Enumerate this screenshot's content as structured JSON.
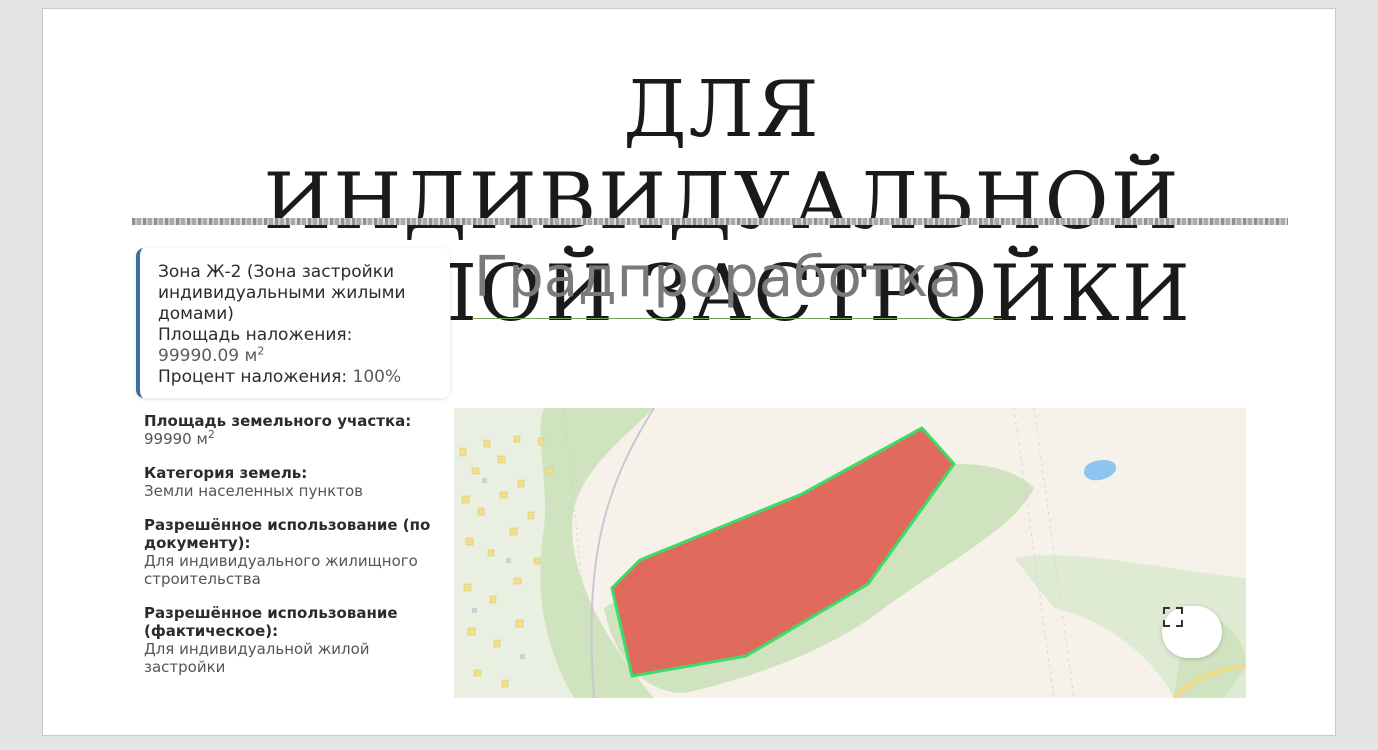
{
  "slide": {
    "title_line1": "Для индивидуальной",
    "title_line2": "жилой застройки",
    "subtitle": "Градпроработка"
  },
  "zone_card": {
    "zone_name": "Зона Ж-2 (Зона застройки индивидуальными жилыми домами)",
    "overlap_area_label": "Площадь наложения:",
    "overlap_area_value": "99990.09 м",
    "overlap_area_unit_sup": "2",
    "overlap_percent_label": "Процент наложения:",
    "overlap_percent_value": "100%"
  },
  "parcel_info": {
    "area_label": "Площадь земельного участка:",
    "area_value": "99990 м",
    "area_unit_sup": "2",
    "category_label": "Категория земель:",
    "category_value": "Земли населенных пунктов",
    "permitted_doc_label": "Разрешённое использование (по документу):",
    "permitted_doc_value": "Для индивидуального жилищного строительства",
    "permitted_actual_label": "Разрешённое использование (фактическое):",
    "permitted_actual_value": "Для индивидуальной жилой застройки"
  },
  "map": {
    "fullscreen_icon": "fullscreen-icon",
    "parcel_fill": "#e06b5c",
    "parcel_outline": "#3ddc6a",
    "forest_color": "#cfe3bf",
    "water_color": "#8ec5f0"
  }
}
